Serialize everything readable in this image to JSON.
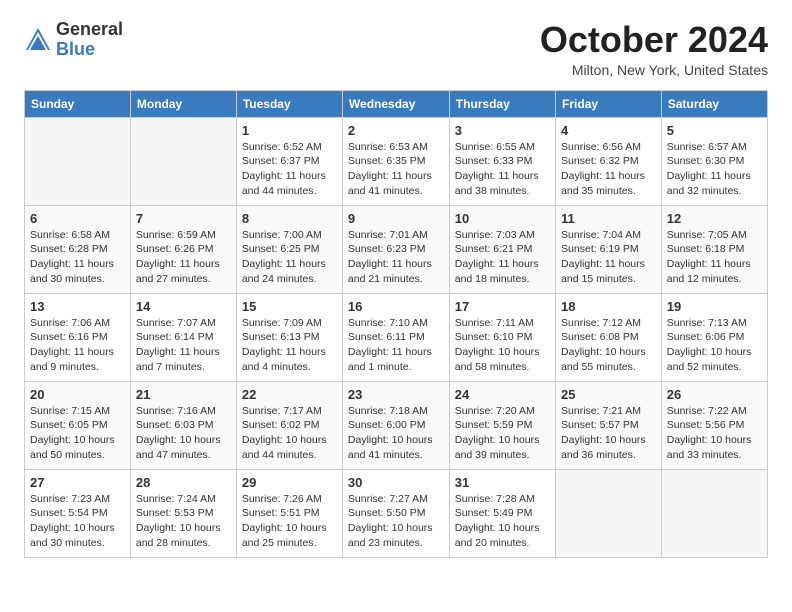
{
  "header": {
    "logo_general": "General",
    "logo_blue": "Blue",
    "title": "October 2024",
    "location": "Milton, New York, United States"
  },
  "calendar": {
    "days_of_week": [
      "Sunday",
      "Monday",
      "Tuesday",
      "Wednesday",
      "Thursday",
      "Friday",
      "Saturday"
    ],
    "weeks": [
      [
        {
          "day": "",
          "info": ""
        },
        {
          "day": "",
          "info": ""
        },
        {
          "day": "1",
          "info": "Sunrise: 6:52 AM\nSunset: 6:37 PM\nDaylight: 11 hours and 44 minutes."
        },
        {
          "day": "2",
          "info": "Sunrise: 6:53 AM\nSunset: 6:35 PM\nDaylight: 11 hours and 41 minutes."
        },
        {
          "day": "3",
          "info": "Sunrise: 6:55 AM\nSunset: 6:33 PM\nDaylight: 11 hours and 38 minutes."
        },
        {
          "day": "4",
          "info": "Sunrise: 6:56 AM\nSunset: 6:32 PM\nDaylight: 11 hours and 35 minutes."
        },
        {
          "day": "5",
          "info": "Sunrise: 6:57 AM\nSunset: 6:30 PM\nDaylight: 11 hours and 32 minutes."
        }
      ],
      [
        {
          "day": "6",
          "info": "Sunrise: 6:58 AM\nSunset: 6:28 PM\nDaylight: 11 hours and 30 minutes."
        },
        {
          "day": "7",
          "info": "Sunrise: 6:59 AM\nSunset: 6:26 PM\nDaylight: 11 hours and 27 minutes."
        },
        {
          "day": "8",
          "info": "Sunrise: 7:00 AM\nSunset: 6:25 PM\nDaylight: 11 hours and 24 minutes."
        },
        {
          "day": "9",
          "info": "Sunrise: 7:01 AM\nSunset: 6:23 PM\nDaylight: 11 hours and 21 minutes."
        },
        {
          "day": "10",
          "info": "Sunrise: 7:03 AM\nSunset: 6:21 PM\nDaylight: 11 hours and 18 minutes."
        },
        {
          "day": "11",
          "info": "Sunrise: 7:04 AM\nSunset: 6:19 PM\nDaylight: 11 hours and 15 minutes."
        },
        {
          "day": "12",
          "info": "Sunrise: 7:05 AM\nSunset: 6:18 PM\nDaylight: 11 hours and 12 minutes."
        }
      ],
      [
        {
          "day": "13",
          "info": "Sunrise: 7:06 AM\nSunset: 6:16 PM\nDaylight: 11 hours and 9 minutes."
        },
        {
          "day": "14",
          "info": "Sunrise: 7:07 AM\nSunset: 6:14 PM\nDaylight: 11 hours and 7 minutes."
        },
        {
          "day": "15",
          "info": "Sunrise: 7:09 AM\nSunset: 6:13 PM\nDaylight: 11 hours and 4 minutes."
        },
        {
          "day": "16",
          "info": "Sunrise: 7:10 AM\nSunset: 6:11 PM\nDaylight: 11 hours and 1 minute."
        },
        {
          "day": "17",
          "info": "Sunrise: 7:11 AM\nSunset: 6:10 PM\nDaylight: 10 hours and 58 minutes."
        },
        {
          "day": "18",
          "info": "Sunrise: 7:12 AM\nSunset: 6:08 PM\nDaylight: 10 hours and 55 minutes."
        },
        {
          "day": "19",
          "info": "Sunrise: 7:13 AM\nSunset: 6:06 PM\nDaylight: 10 hours and 52 minutes."
        }
      ],
      [
        {
          "day": "20",
          "info": "Sunrise: 7:15 AM\nSunset: 6:05 PM\nDaylight: 10 hours and 50 minutes."
        },
        {
          "day": "21",
          "info": "Sunrise: 7:16 AM\nSunset: 6:03 PM\nDaylight: 10 hours and 47 minutes."
        },
        {
          "day": "22",
          "info": "Sunrise: 7:17 AM\nSunset: 6:02 PM\nDaylight: 10 hours and 44 minutes."
        },
        {
          "day": "23",
          "info": "Sunrise: 7:18 AM\nSunset: 6:00 PM\nDaylight: 10 hours and 41 minutes."
        },
        {
          "day": "24",
          "info": "Sunrise: 7:20 AM\nSunset: 5:59 PM\nDaylight: 10 hours and 39 minutes."
        },
        {
          "day": "25",
          "info": "Sunrise: 7:21 AM\nSunset: 5:57 PM\nDaylight: 10 hours and 36 minutes."
        },
        {
          "day": "26",
          "info": "Sunrise: 7:22 AM\nSunset: 5:56 PM\nDaylight: 10 hours and 33 minutes."
        }
      ],
      [
        {
          "day": "27",
          "info": "Sunrise: 7:23 AM\nSunset: 5:54 PM\nDaylight: 10 hours and 30 minutes."
        },
        {
          "day": "28",
          "info": "Sunrise: 7:24 AM\nSunset: 5:53 PM\nDaylight: 10 hours and 28 minutes."
        },
        {
          "day": "29",
          "info": "Sunrise: 7:26 AM\nSunset: 5:51 PM\nDaylight: 10 hours and 25 minutes."
        },
        {
          "day": "30",
          "info": "Sunrise: 7:27 AM\nSunset: 5:50 PM\nDaylight: 10 hours and 23 minutes."
        },
        {
          "day": "31",
          "info": "Sunrise: 7:28 AM\nSunset: 5:49 PM\nDaylight: 10 hours and 20 minutes."
        },
        {
          "day": "",
          "info": ""
        },
        {
          "day": "",
          "info": ""
        }
      ]
    ]
  }
}
